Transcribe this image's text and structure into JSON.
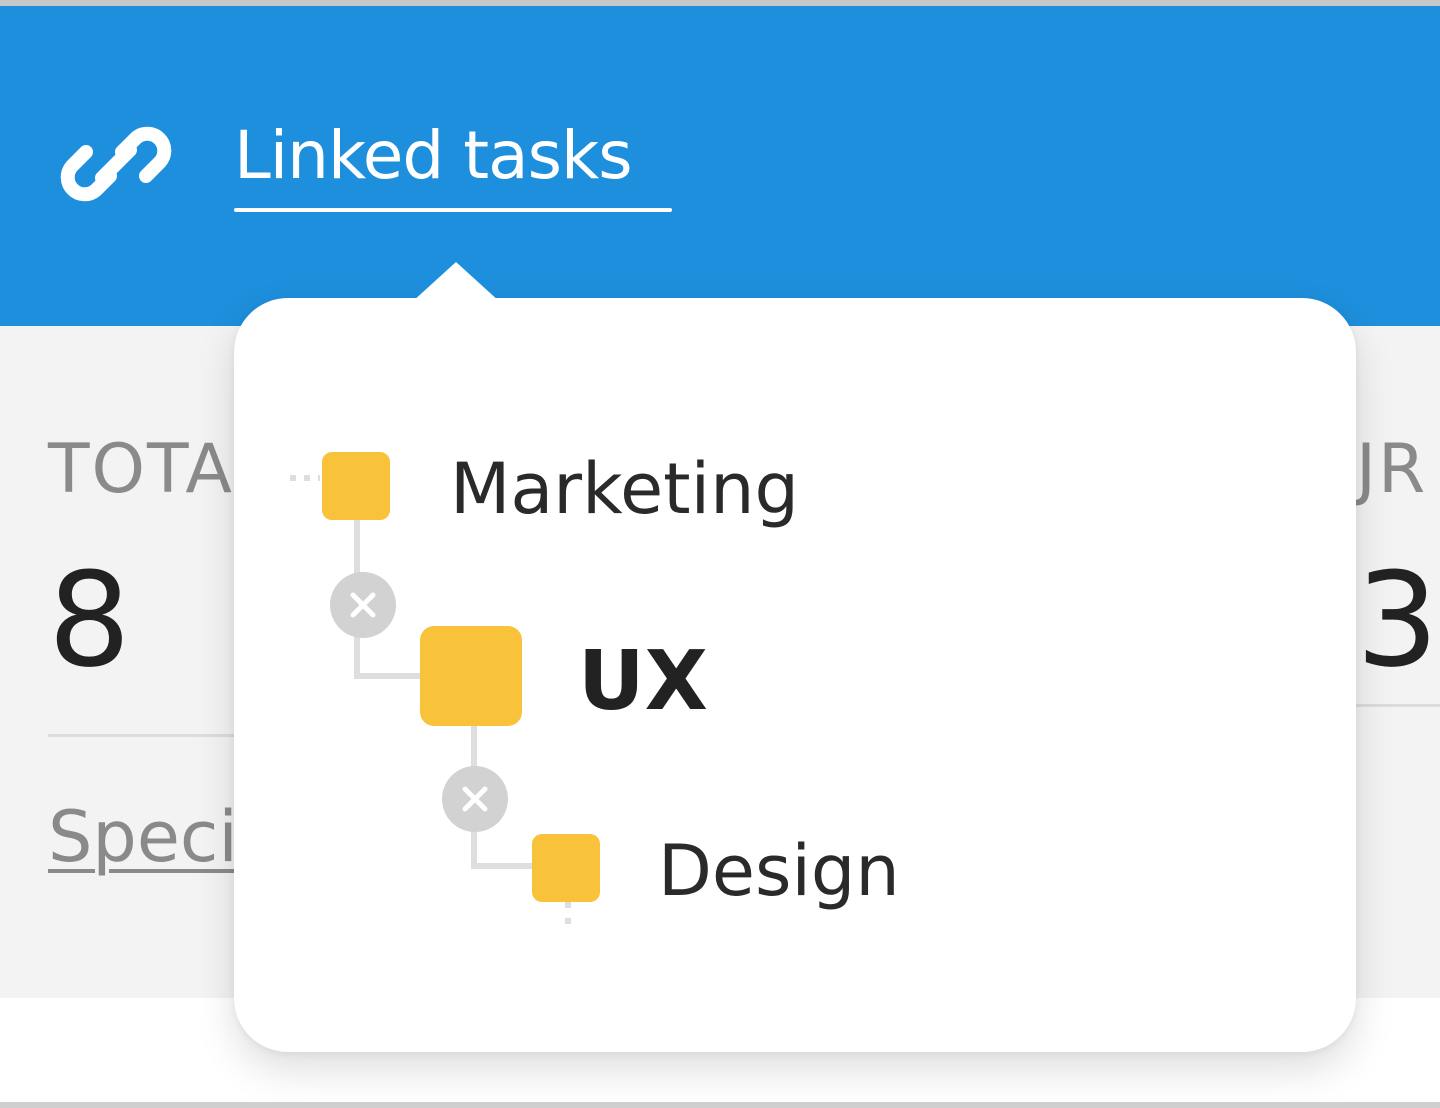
{
  "header": {
    "tab_label": "Linked tasks",
    "link_icon": "link-icon",
    "background_color": "#1e8fdc"
  },
  "stats": {
    "left_label": "TOTA",
    "left_value": "8",
    "right_label": "JR",
    "right_value": "3",
    "specs_link": "Speci"
  },
  "linked_tasks": {
    "node_color": "#f8c33a",
    "items": [
      {
        "label": "Marketing",
        "level": 0
      },
      {
        "label": "UX",
        "level": 1,
        "current": true
      },
      {
        "label": "Design",
        "level": 2
      }
    ],
    "unlink_icon": "close-icon"
  }
}
